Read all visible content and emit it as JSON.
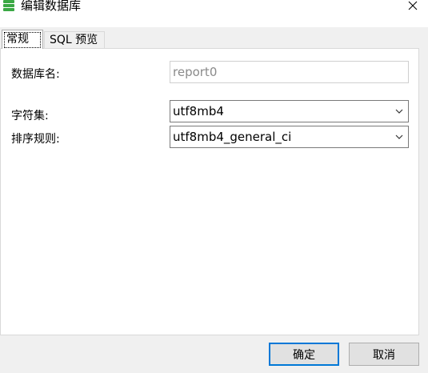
{
  "window": {
    "title": "编辑数据库",
    "icon": "database-icon",
    "close_icon": "close-icon"
  },
  "tabs": [
    {
      "label": "常规",
      "active": true
    },
    {
      "label": "SQL 预览",
      "active": false
    }
  ],
  "form": {
    "name_label": "数据库名:",
    "name_value": "report0",
    "charset_label": "字符集:",
    "charset_value": "utf8mb4",
    "collation_label": "排序规则:",
    "collation_value": "utf8mb4_general_ci"
  },
  "buttons": {
    "ok": "确定",
    "cancel": "取消"
  },
  "colors": {
    "accent": "#0078d7",
    "icon_green": "#3aa844"
  }
}
